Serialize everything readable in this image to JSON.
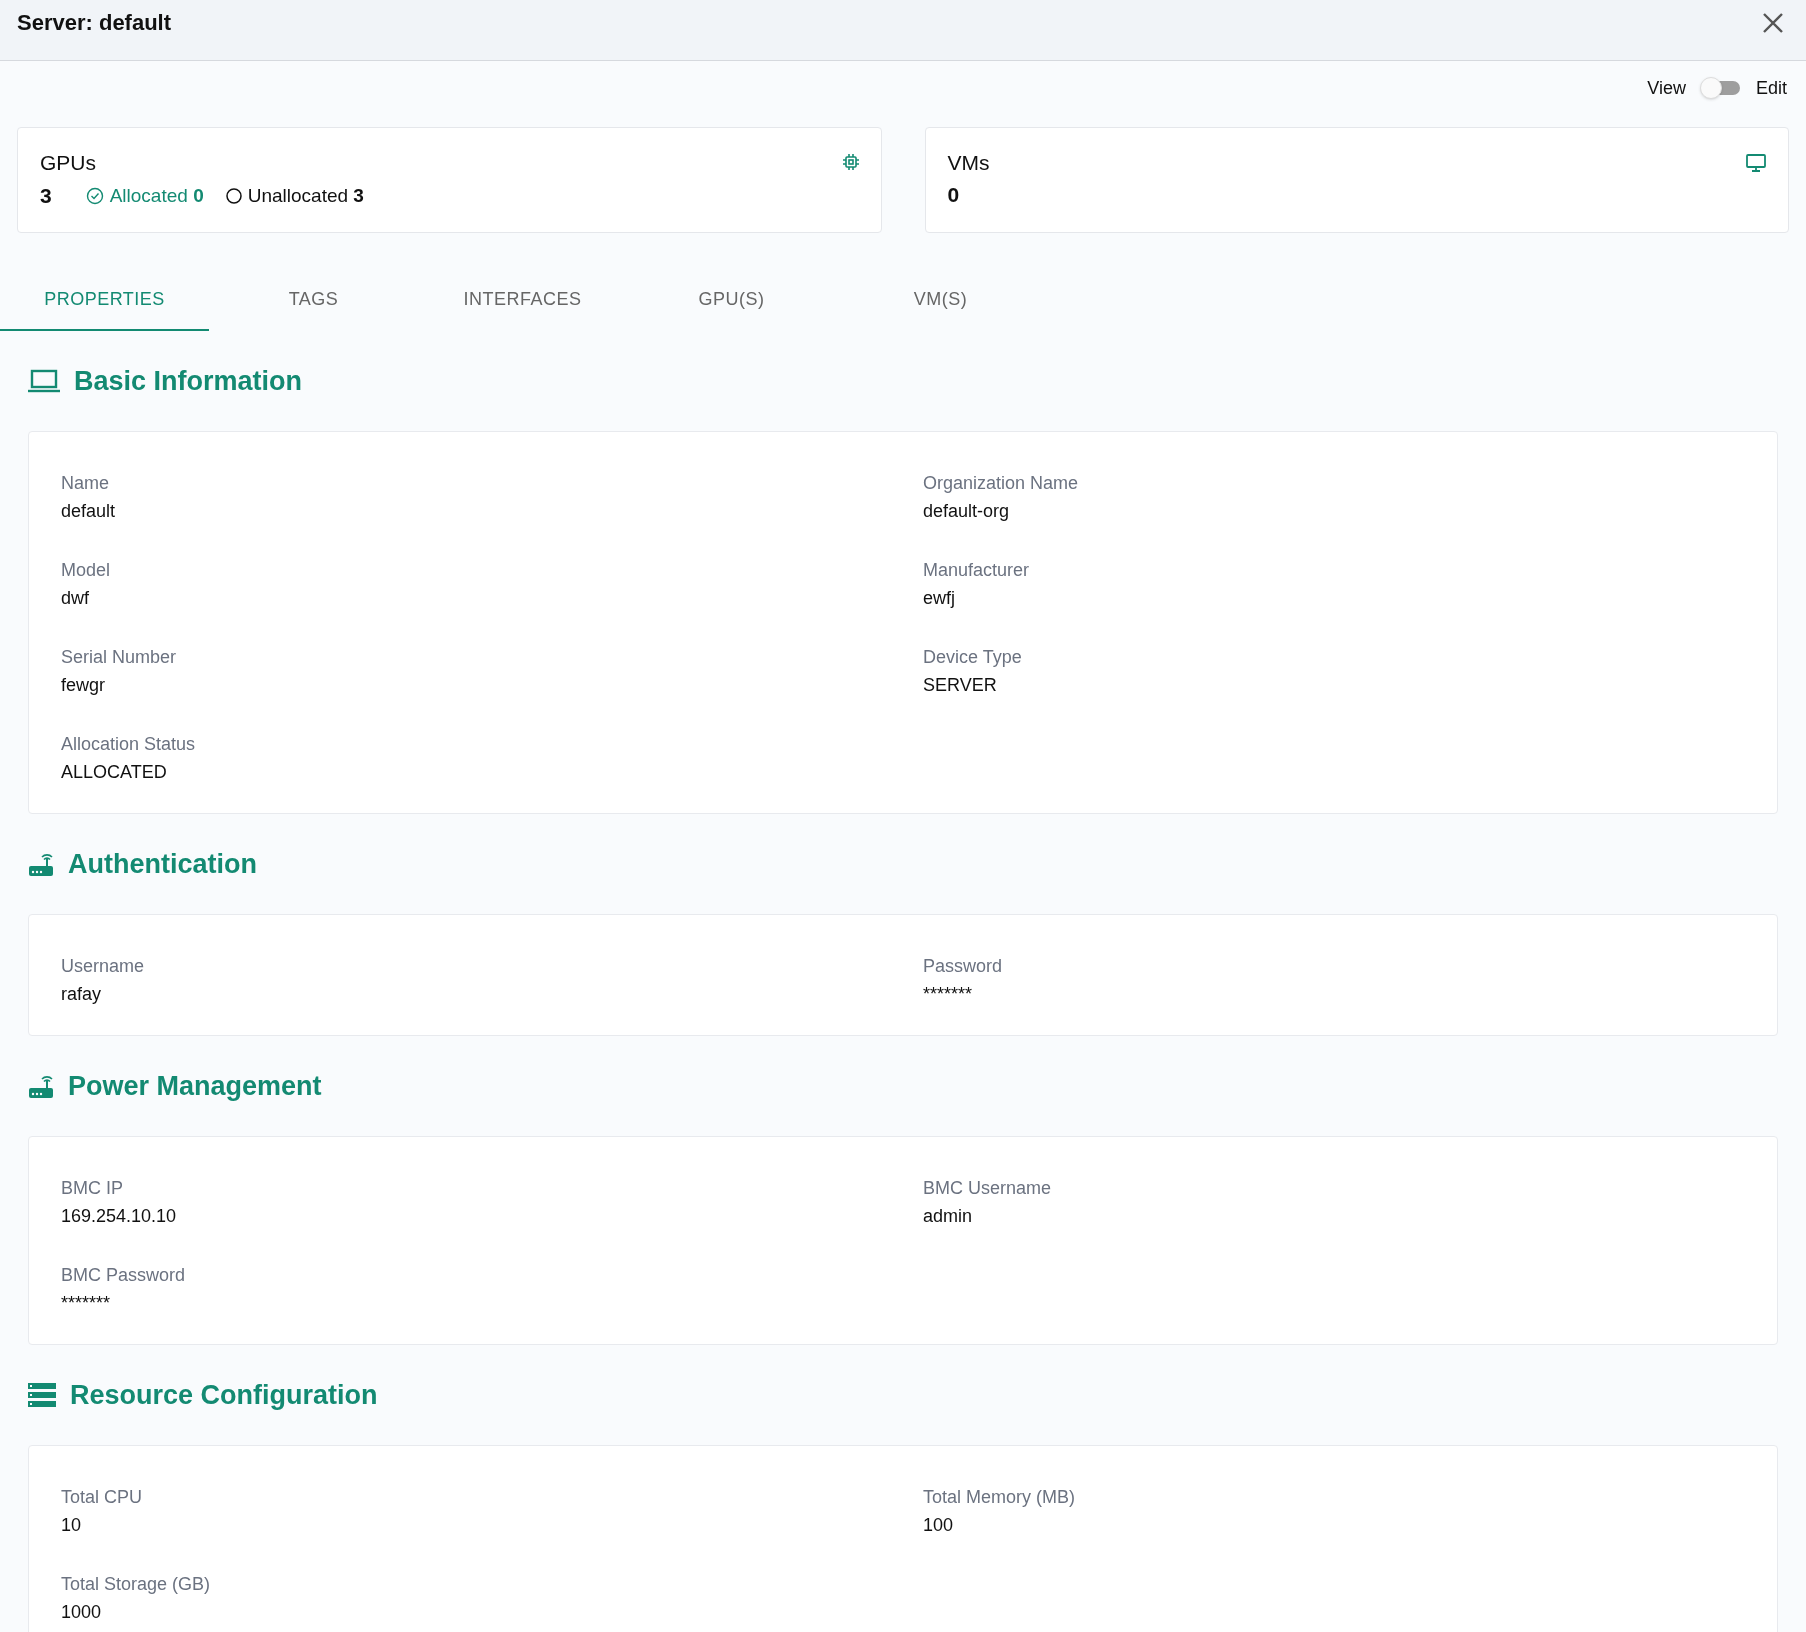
{
  "window": {
    "title": "Server: default"
  },
  "mode_toggle": {
    "left_label": "View",
    "right_label": "Edit",
    "on": false
  },
  "summary_cards": [
    {
      "kind": "gpus",
      "title": "GPUs",
      "count": "3",
      "allocated_label": "Allocated",
      "allocated_count": "0",
      "unallocated_label": "Unallocated",
      "unallocated_count": "3"
    },
    {
      "kind": "vms",
      "title": "VMs",
      "count": "0"
    }
  ],
  "tabs": [
    {
      "label": "PROPERTIES",
      "selected": true
    },
    {
      "label": "TAGS",
      "selected": false
    },
    {
      "label": "INTERFACES",
      "selected": false
    },
    {
      "label": "GPU(S)",
      "selected": false
    },
    {
      "label": "VM(S)",
      "selected": false
    }
  ],
  "sections": [
    {
      "kind": "laptop",
      "title": "Basic Information",
      "fields": [
        {
          "label": "Name",
          "value": "default"
        },
        {
          "label": "Organization Name",
          "value": "default-org"
        },
        {
          "label": "Model",
          "value": "dwf"
        },
        {
          "label": "Manufacturer",
          "value": "ewfj"
        },
        {
          "label": "Serial Number",
          "value": "fewgr"
        },
        {
          "label": "Device Type",
          "value": "SERVER"
        },
        {
          "label": "Allocation Status",
          "value": "ALLOCATED"
        }
      ]
    },
    {
      "kind": "router",
      "title": "Authentication",
      "fields": [
        {
          "label": "Username",
          "value": "rafay"
        },
        {
          "label": "Password",
          "value": "*******"
        }
      ]
    },
    {
      "kind": "router",
      "title": "Power Management",
      "fields": [
        {
          "label": "BMC IP",
          "value": "169.254.10.10"
        },
        {
          "label": "BMC Username",
          "value": "admin"
        },
        {
          "label": "BMC Password",
          "value": "*******"
        }
      ]
    },
    {
      "kind": "server",
      "title": "Resource Configuration",
      "fields": [
        {
          "label": "Total CPU",
          "value": "10"
        },
        {
          "label": "Total Memory (MB)",
          "value": "100"
        },
        {
          "label": "Total Storage (GB)",
          "value": "1000"
        }
      ]
    }
  ]
}
